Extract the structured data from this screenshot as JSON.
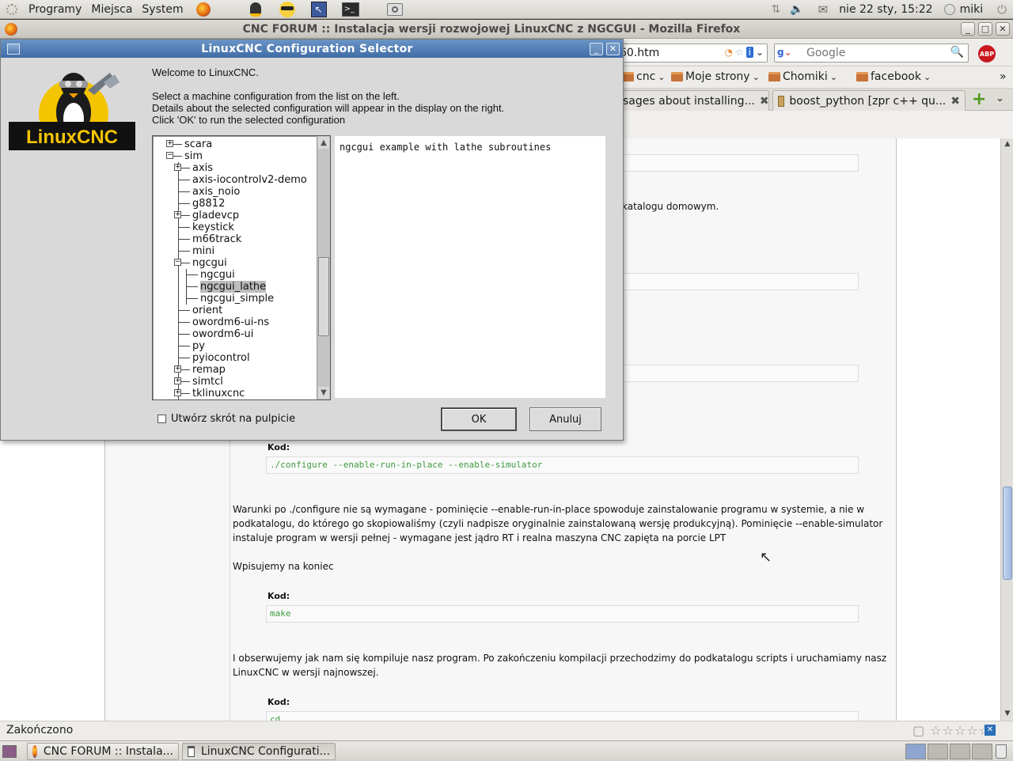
{
  "top_panel": {
    "menus": [
      "Programy",
      "Miejsca",
      "System"
    ],
    "clock": "nie 22 sty, 15:22",
    "user": "miki"
  },
  "firefox": {
    "title": "CNC FORUM :: Instalacja wersji rozwojowej LinuxCNC z NGCGUI - Mozilla Firefox",
    "url_fragment": "60.htm",
    "search_placeholder": "Google",
    "bookmarks": [
      "cnc",
      "Moje strony",
      "Chomiki",
      "facebook"
    ],
    "tabs": [
      "sages about installing...",
      "boost_python [zpr c++ qu..."
    ],
    "status_text": "Zakończono"
  },
  "page": {
    "visible_fragment": "katalogu domowym.",
    "code_label": "Kod:",
    "code1": "./configure --enable-run-in-place --enable-simulator",
    "para1": "Warunki po ./configure nie są wymagane - pominięcie --enable-run-in-place spowoduje zainstalowanie programu w systemie, a nie w podkatalogu, do którego go skopiowaliśmy (czyli nadpisze oryginalnie zainstalowaną wersję produkcyjną). Pominięcie --enable-simulator instaluje program w wersji pełnej - wymagane jest jądro RT i realna maszyna CNC zapięta na porcie LPT",
    "para2": "Wpisujemy na koniec",
    "code2": "make",
    "para3": "I obserwujemy jak nam się kompiluje nasz program. Po zakończeniu kompilacji przechodzimy do podkatalogu scripts i uruchamiamy nasz LinuxCNC w wersji najnowszej.",
    "code3": "cd .."
  },
  "dialog": {
    "title": "LinuxCNC Configuration Selector",
    "logo_text": "LinuxCNC",
    "welcome": "Welcome to LinuxCNC.",
    "instr1": "Select a machine configuration from the list on the left.",
    "instr2": "Details about the selected configuration will appear in the display on the right.",
    "instr3": "Click 'OK' to run the selected configuration",
    "tree": [
      {
        "label": "scara",
        "level": 0,
        "toggle": "+"
      },
      {
        "label": "sim",
        "level": 0,
        "toggle": "-"
      },
      {
        "label": "axis",
        "level": 1,
        "toggle": "+"
      },
      {
        "label": "axis-iocontrolv2-demo",
        "level": 1,
        "toggle": ""
      },
      {
        "label": "axis_noio",
        "level": 1,
        "toggle": ""
      },
      {
        "label": "g8812",
        "level": 1,
        "toggle": ""
      },
      {
        "label": "gladevcp",
        "level": 1,
        "toggle": "+"
      },
      {
        "label": "keystick",
        "level": 1,
        "toggle": ""
      },
      {
        "label": "m66track",
        "level": 1,
        "toggle": ""
      },
      {
        "label": "mini",
        "level": 1,
        "toggle": ""
      },
      {
        "label": "ngcgui",
        "level": 1,
        "toggle": "-"
      },
      {
        "label": "ngcgui",
        "level": 2,
        "toggle": ""
      },
      {
        "label": "ngcgui_lathe",
        "level": 2,
        "toggle": "",
        "selected": true
      },
      {
        "label": "ngcgui_simple",
        "level": 2,
        "toggle": ""
      },
      {
        "label": "orient",
        "level": 1,
        "toggle": ""
      },
      {
        "label": "owordm6-ui-ns",
        "level": 1,
        "toggle": ""
      },
      {
        "label": "owordm6-ui",
        "level": 1,
        "toggle": ""
      },
      {
        "label": "py",
        "level": 1,
        "toggle": ""
      },
      {
        "label": "pyiocontrol",
        "level": 1,
        "toggle": ""
      },
      {
        "label": "remap",
        "level": 1,
        "toggle": "+"
      },
      {
        "label": "simtcl",
        "level": 1,
        "toggle": "+"
      },
      {
        "label": "tklinuxcnc",
        "level": 1,
        "toggle": "+"
      }
    ],
    "details": "ngcgui example with lathe subroutines",
    "shortcut_label": "Utwórz skrót na pulpicie",
    "ok_label": "OK",
    "cancel_label": "Anuluj"
  },
  "taskbar": {
    "tasks": [
      "CNC FORUM :: Instala...",
      "LinuxCNC Configurati..."
    ]
  },
  "colors": {
    "dialog_title": "#4a76ae",
    "panel": "#dedcd7",
    "code_text": "#3e9a3e"
  }
}
